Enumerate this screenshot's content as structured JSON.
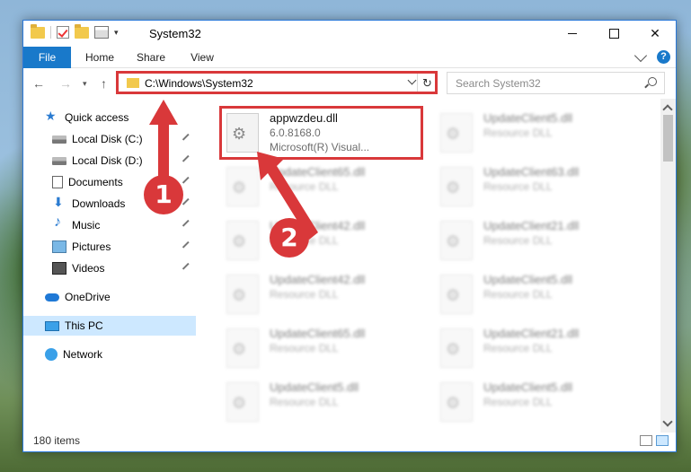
{
  "window": {
    "title": "System32",
    "controls": {
      "minimize": "—",
      "maximize": "☐",
      "close": "✕"
    }
  },
  "ribbon": {
    "tabs": [
      "File",
      "Home",
      "Share",
      "View"
    ],
    "help": "?"
  },
  "nav": {
    "back": "←",
    "forward": "→",
    "up": "↑",
    "address": "C:\\Windows\\System32",
    "refresh": "↻",
    "search_placeholder": "Search System32"
  },
  "sidebar": {
    "items": [
      {
        "label": "Quick access",
        "icon": "star-icon"
      },
      {
        "label": "Local Disk (C:)",
        "icon": "disk-icon"
      },
      {
        "label": "Local Disk (D:)",
        "icon": "disk-icon"
      },
      {
        "label": "Documents",
        "icon": "documents-icon"
      },
      {
        "label": "Downloads",
        "icon": "download-icon"
      },
      {
        "label": "Music",
        "icon": "music-icon"
      },
      {
        "label": "Pictures",
        "icon": "pictures-icon"
      },
      {
        "label": "Videos",
        "icon": "videos-icon"
      },
      {
        "label": "OneDrive",
        "icon": "cloud-icon"
      },
      {
        "label": "This PC",
        "icon": "pc-icon"
      },
      {
        "label": "Network",
        "icon": "network-icon"
      }
    ]
  },
  "files": [
    {
      "name": "appwzdeu.dll",
      "line2": "6.0.8168.0",
      "line3": "Microsoft(R) Visual..."
    },
    {
      "name": "UpdateClient5.dll",
      "line2": "Resource DLL"
    },
    {
      "name": "UpdateClient65.dll",
      "line2": "Resource DLL"
    },
    {
      "name": "UpdateClient63.dll",
      "line2": "Resource DLL"
    },
    {
      "name": "UpdateClient42.dll",
      "line2": "Resource DLL"
    },
    {
      "name": "UpdateClient21.dll",
      "line2": "Resource DLL"
    },
    {
      "name": "UpdateClient42.dll",
      "line2": "Resource DLL"
    },
    {
      "name": "UpdateClient5.dll",
      "line2": "Resource DLL"
    },
    {
      "name": "UpdateClient65.dll",
      "line2": "Resource DLL"
    },
    {
      "name": "UpdateClient21.dll",
      "line2": "Resource DLL"
    },
    {
      "name": "UpdateClient5.dll",
      "line2": "Resource DLL"
    },
    {
      "name": "UpdateClient5.dll",
      "line2": "Resource DLL"
    }
  ],
  "status": {
    "count": "180 items"
  },
  "annotations": {
    "step1": "1",
    "step2": "2",
    "color": "#d9383a"
  }
}
